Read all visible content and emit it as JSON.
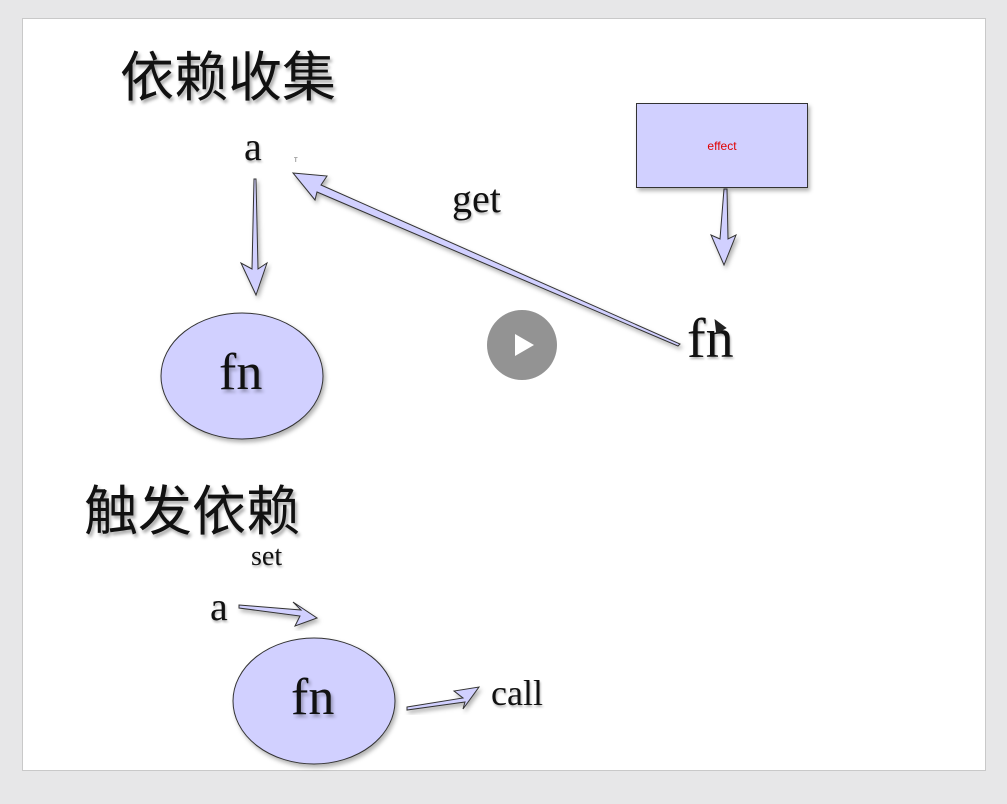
{
  "collect": {
    "title": "依赖收集",
    "var_a": "a",
    "fn_ellipse": "fn",
    "get_label": "get",
    "fn_right": "fn",
    "effect_label": "effect",
    "tiny_mark": "T"
  },
  "trigger": {
    "title": "触发依赖",
    "set_label": "set",
    "var_a": "a",
    "fn_ellipse": "fn",
    "call_label": "call"
  },
  "colors": {
    "shape_fill": "#d1d0ff",
    "effect_text": "#e00000",
    "play_button": "#808080"
  },
  "icons": {
    "play": "play-icon",
    "cursor": "mouse-cursor-icon"
  }
}
